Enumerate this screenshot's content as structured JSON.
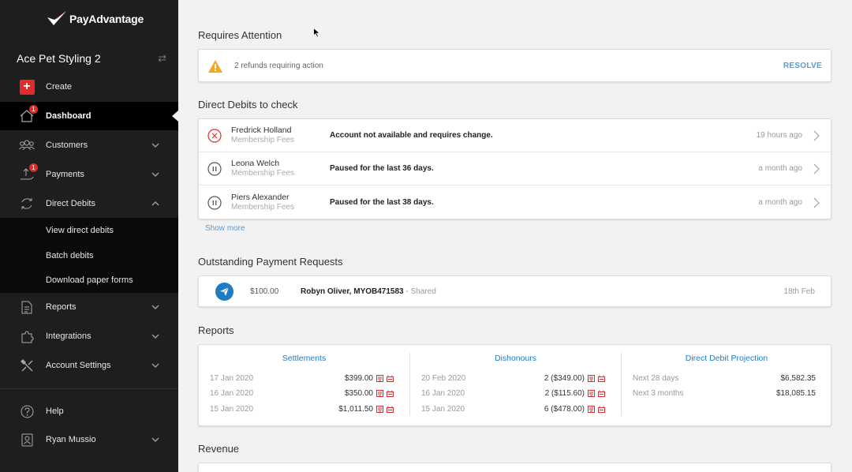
{
  "brand": {
    "name": "PayAdvantage"
  },
  "sidebar": {
    "org_name": "Ace Pet Styling 2",
    "create_label": "Create",
    "items": [
      {
        "label": "Dashboard",
        "badge": "1"
      },
      {
        "label": "Customers"
      },
      {
        "label": "Payments",
        "badge": "1"
      },
      {
        "label": "Direct Debits"
      },
      {
        "label": "Reports"
      },
      {
        "label": "Integrations"
      },
      {
        "label": "Account Settings"
      }
    ],
    "sub_items": [
      "View direct debits",
      "Batch debits",
      "Download paper forms"
    ],
    "help_label": "Help",
    "user_name": "Ryan Mussio"
  },
  "attention": {
    "title": "Requires Attention",
    "message": "2 refunds requiring action",
    "action_label": "RESOLVE"
  },
  "direct_debits": {
    "title": "Direct Debits to check",
    "rows": [
      {
        "name": "Fredrick Holland",
        "sub": "Membership Fees",
        "message": "Account not available and requires change.",
        "time": "19 hours ago",
        "icon": "error-circle-icon"
      },
      {
        "name": "Leona Welch",
        "sub": "Membership Fees",
        "message": "Paused for the last 36 days.",
        "time": "a month ago",
        "icon": "pause-circle-icon"
      },
      {
        "name": "Piers Alexander",
        "sub": "Membership Fees",
        "message": "Paused for the last 38 days.",
        "time": "a month ago",
        "icon": "pause-circle-icon"
      }
    ],
    "show_more": "Show more"
  },
  "payment_requests": {
    "title": "Outstanding Payment Requests",
    "row": {
      "amount": "$100.00",
      "name": "Robyn Oliver, MYOB471583",
      "status": " - Shared",
      "date": "18th Feb"
    }
  },
  "reports": {
    "title": "Reports",
    "settlements": {
      "heading": "Settlements",
      "rows": [
        {
          "date": "17 Jan 2020",
          "value": "$399.00"
        },
        {
          "date": "16 Jan 2020",
          "value": "$350.00"
        },
        {
          "date": "15 Jan 2020",
          "value": "$1,011.50"
        }
      ]
    },
    "dishonours": {
      "heading": "Dishonours",
      "rows": [
        {
          "date": "20 Feb 2020",
          "value": "2 ($349.00)"
        },
        {
          "date": "16 Jan 2020",
          "value": "2 ($115.60)"
        },
        {
          "date": "15 Jan 2020",
          "value": "6 ($478.00)"
        }
      ]
    },
    "projection": {
      "heading": "Direct Debit Projection",
      "rows": [
        {
          "label": "Next 28 days",
          "value": "$6,582.35"
        },
        {
          "label": "Next 3 months",
          "value": "$18,085.15"
        }
      ]
    }
  },
  "revenue": {
    "title": "Revenue"
  },
  "colors": {
    "accent": "#1e7bc4",
    "danger": "#e02b2b",
    "warning": "#f5a623",
    "link": "#5b9bd5"
  }
}
